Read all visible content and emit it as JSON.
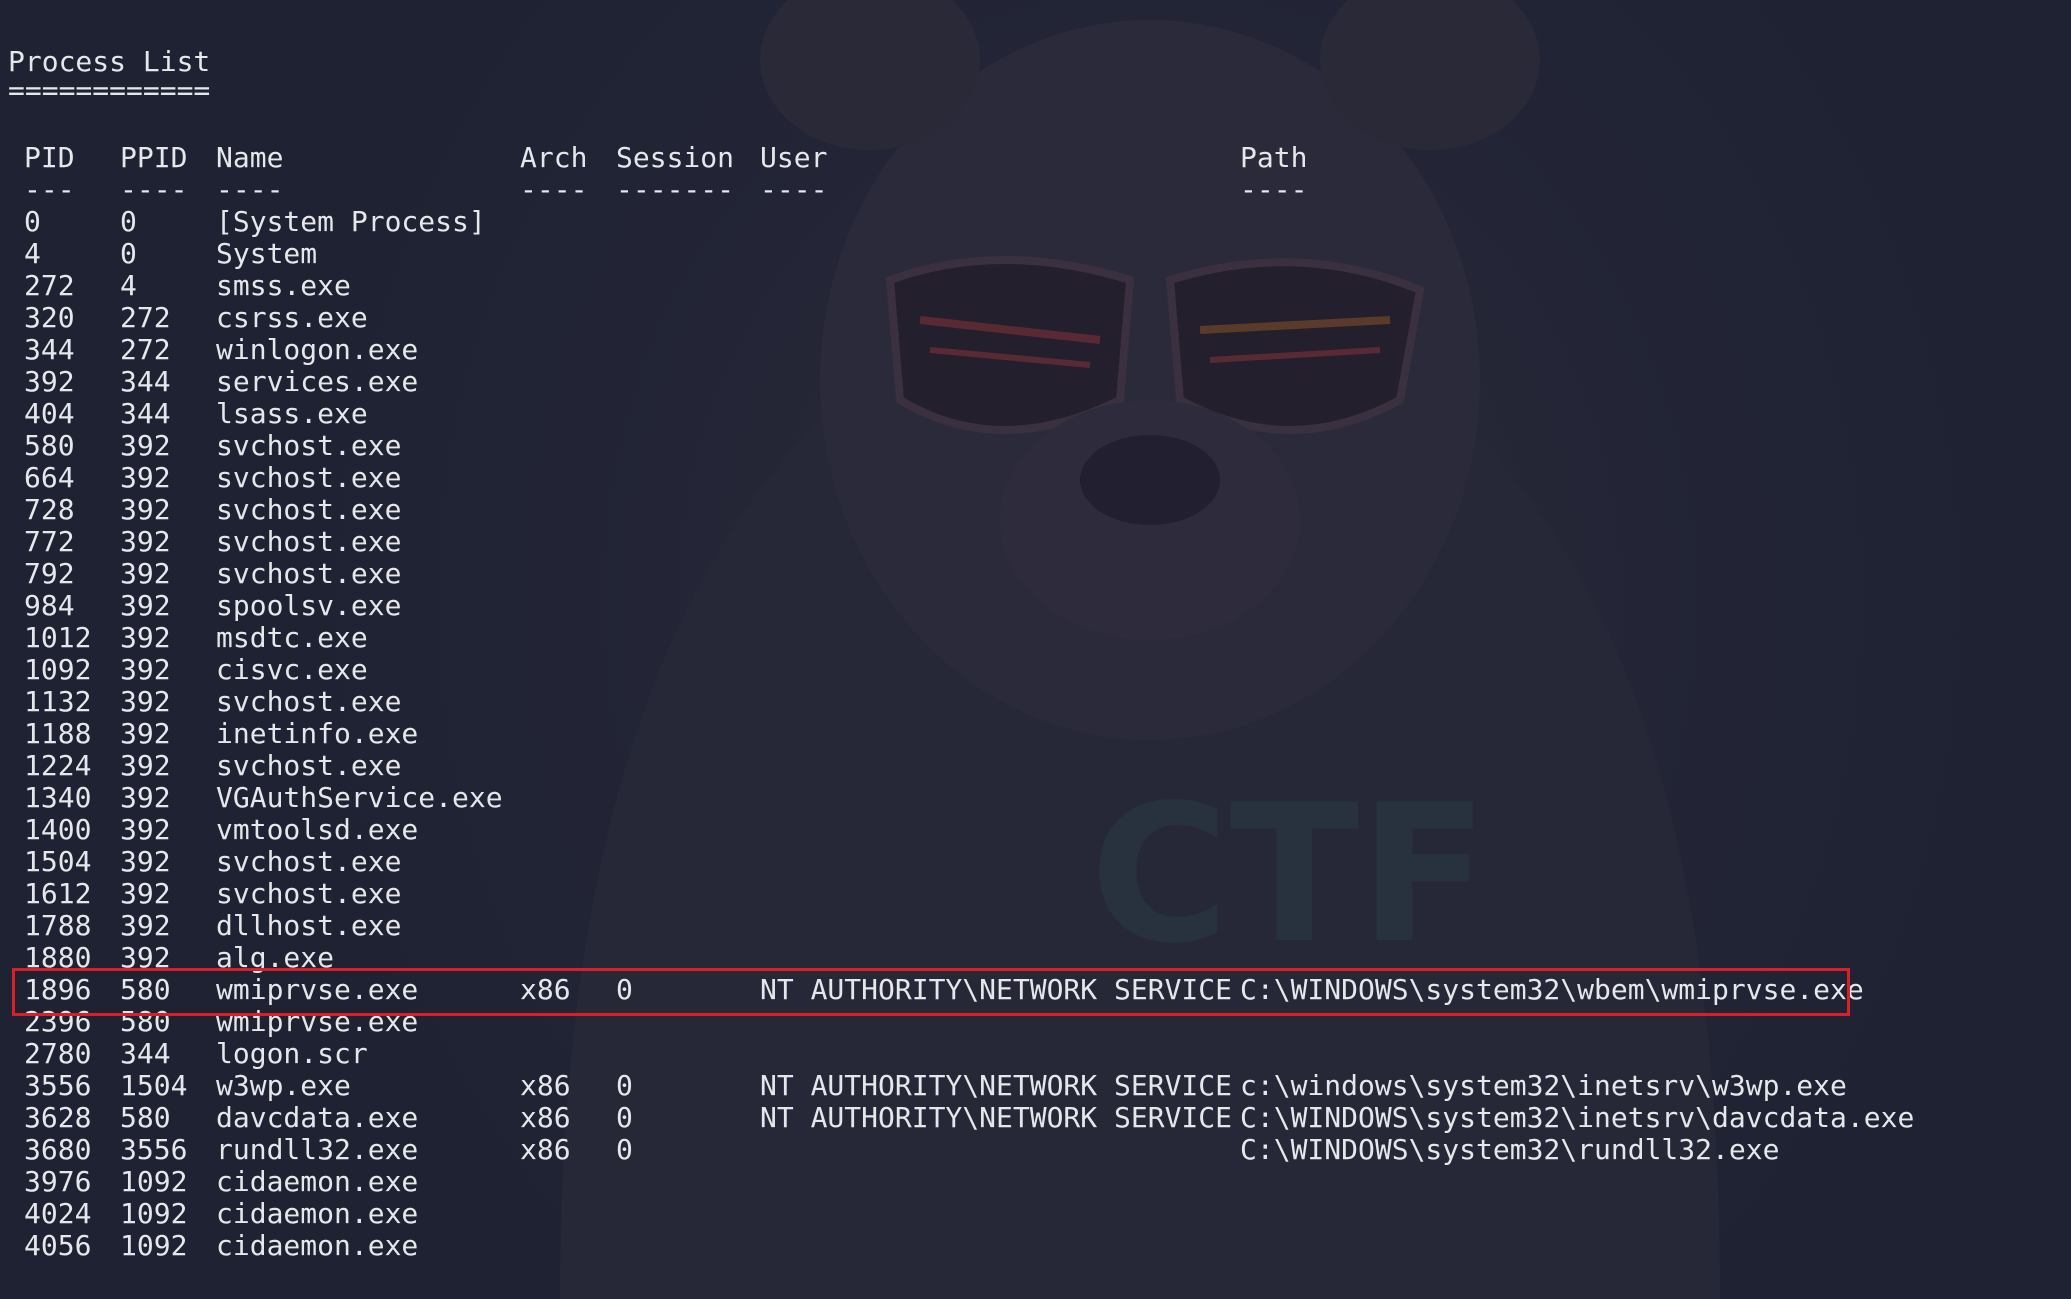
{
  "terminal": {
    "title": "Process List",
    "title_underline": "============",
    "headers": {
      "pid": "PID",
      "ppid": "PPID",
      "name": "Name",
      "arch": "Arch",
      "session": "Session",
      "user": "User",
      "path": "Path"
    },
    "header_dashes": {
      "pid": "---",
      "ppid": "----",
      "name": "----",
      "arch": "----",
      "session": "-------",
      "user": "----",
      "path": "----"
    },
    "rows": [
      {
        "pid": "0",
        "ppid": "0",
        "name": "[System Process]",
        "arch": "",
        "session": "",
        "user": "",
        "path": ""
      },
      {
        "pid": "4",
        "ppid": "0",
        "name": "System",
        "arch": "",
        "session": "",
        "user": "",
        "path": ""
      },
      {
        "pid": "272",
        "ppid": "4",
        "name": "smss.exe",
        "arch": "",
        "session": "",
        "user": "",
        "path": ""
      },
      {
        "pid": "320",
        "ppid": "272",
        "name": "csrss.exe",
        "arch": "",
        "session": "",
        "user": "",
        "path": ""
      },
      {
        "pid": "344",
        "ppid": "272",
        "name": "winlogon.exe",
        "arch": "",
        "session": "",
        "user": "",
        "path": ""
      },
      {
        "pid": "392",
        "ppid": "344",
        "name": "services.exe",
        "arch": "",
        "session": "",
        "user": "",
        "path": ""
      },
      {
        "pid": "404",
        "ppid": "344",
        "name": "lsass.exe",
        "arch": "",
        "session": "",
        "user": "",
        "path": ""
      },
      {
        "pid": "580",
        "ppid": "392",
        "name": "svchost.exe",
        "arch": "",
        "session": "",
        "user": "",
        "path": ""
      },
      {
        "pid": "664",
        "ppid": "392",
        "name": "svchost.exe",
        "arch": "",
        "session": "",
        "user": "",
        "path": ""
      },
      {
        "pid": "728",
        "ppid": "392",
        "name": "svchost.exe",
        "arch": "",
        "session": "",
        "user": "",
        "path": ""
      },
      {
        "pid": "772",
        "ppid": "392",
        "name": "svchost.exe",
        "arch": "",
        "session": "",
        "user": "",
        "path": ""
      },
      {
        "pid": "792",
        "ppid": "392",
        "name": "svchost.exe",
        "arch": "",
        "session": "",
        "user": "",
        "path": ""
      },
      {
        "pid": "984",
        "ppid": "392",
        "name": "spoolsv.exe",
        "arch": "",
        "session": "",
        "user": "",
        "path": ""
      },
      {
        "pid": "1012",
        "ppid": "392",
        "name": "msdtc.exe",
        "arch": "",
        "session": "",
        "user": "",
        "path": ""
      },
      {
        "pid": "1092",
        "ppid": "392",
        "name": "cisvc.exe",
        "arch": "",
        "session": "",
        "user": "",
        "path": ""
      },
      {
        "pid": "1132",
        "ppid": "392",
        "name": "svchost.exe",
        "arch": "",
        "session": "",
        "user": "",
        "path": ""
      },
      {
        "pid": "1188",
        "ppid": "392",
        "name": "inetinfo.exe",
        "arch": "",
        "session": "",
        "user": "",
        "path": ""
      },
      {
        "pid": "1224",
        "ppid": "392",
        "name": "svchost.exe",
        "arch": "",
        "session": "",
        "user": "",
        "path": ""
      },
      {
        "pid": "1340",
        "ppid": "392",
        "name": "VGAuthService.exe",
        "arch": "",
        "session": "",
        "user": "",
        "path": ""
      },
      {
        "pid": "1400",
        "ppid": "392",
        "name": "vmtoolsd.exe",
        "arch": "",
        "session": "",
        "user": "",
        "path": ""
      },
      {
        "pid": "1504",
        "ppid": "392",
        "name": "svchost.exe",
        "arch": "",
        "session": "",
        "user": "",
        "path": ""
      },
      {
        "pid": "1612",
        "ppid": "392",
        "name": "svchost.exe",
        "arch": "",
        "session": "",
        "user": "",
        "path": ""
      },
      {
        "pid": "1788",
        "ppid": "392",
        "name": "dllhost.exe",
        "arch": "",
        "session": "",
        "user": "",
        "path": ""
      },
      {
        "pid": "1880",
        "ppid": "392",
        "name": "alg.exe",
        "arch": "",
        "session": "",
        "user": "",
        "path": ""
      },
      {
        "pid": "1896",
        "ppid": "580",
        "name": "wmiprvse.exe",
        "arch": "x86",
        "session": "0",
        "user": "NT AUTHORITY\\NETWORK SERVICE",
        "path": "C:\\WINDOWS\\system32\\wbem\\wmiprvse.exe"
      },
      {
        "pid": "2396",
        "ppid": "580",
        "name": "wmiprvse.exe",
        "arch": "",
        "session": "",
        "user": "",
        "path": ""
      },
      {
        "pid": "2780",
        "ppid": "344",
        "name": "logon.scr",
        "arch": "",
        "session": "",
        "user": "",
        "path": ""
      },
      {
        "pid": "3556",
        "ppid": "1504",
        "name": "w3wp.exe",
        "arch": "x86",
        "session": "0",
        "user": "NT AUTHORITY\\NETWORK SERVICE",
        "path": "c:\\windows\\system32\\inetsrv\\w3wp.exe"
      },
      {
        "pid": "3628",
        "ppid": "580",
        "name": "davcdata.exe",
        "arch": "x86",
        "session": "0",
        "user": "NT AUTHORITY\\NETWORK SERVICE",
        "path": "C:\\WINDOWS\\system32\\inetsrv\\davcdata.exe"
      },
      {
        "pid": "3680",
        "ppid": "3556",
        "name": "rundll32.exe",
        "arch": "x86",
        "session": "0",
        "user": "",
        "path": "C:\\WINDOWS\\system32\\rundll32.exe"
      },
      {
        "pid": "3976",
        "ppid": "1092",
        "name": "cidaemon.exe",
        "arch": "",
        "session": "",
        "user": "",
        "path": ""
      },
      {
        "pid": "4024",
        "ppid": "1092",
        "name": "cidaemon.exe",
        "arch": "",
        "session": "",
        "user": "",
        "path": ""
      },
      {
        "pid": "4056",
        "ppid": "1092",
        "name": "cidaemon.exe",
        "arch": "",
        "session": "",
        "user": "",
        "path": ""
      }
    ],
    "highlighted_pid": "1896"
  },
  "colors": {
    "background": "#1e2232",
    "text": "#e6e7ea",
    "highlight_border": "#d82028"
  },
  "wallpaper": {
    "logo_text": "CTF",
    "icon": "bear-hoodie-sunglasses-icon"
  }
}
